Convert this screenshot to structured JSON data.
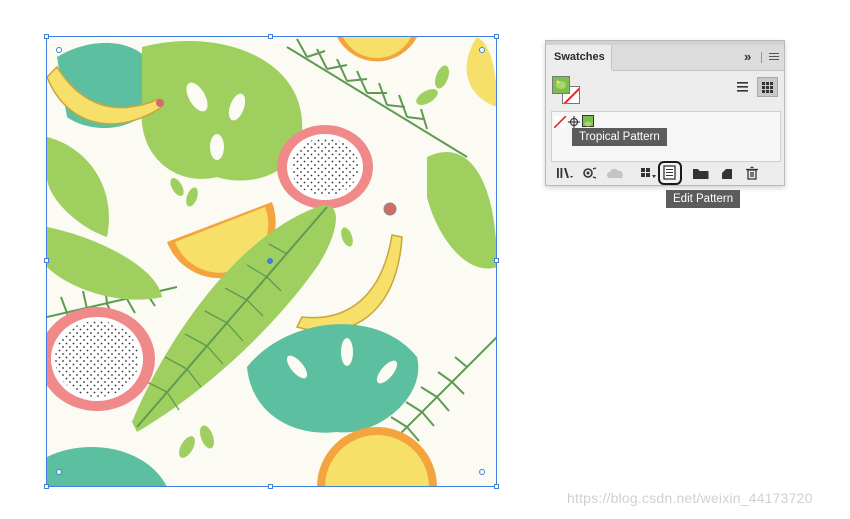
{
  "panel": {
    "tab_label": "Swatches",
    "collapse_glyph": "»",
    "tooltip_swatch_name": "Tropical Pattern",
    "tooltip_edit_pattern": "Edit Pattern",
    "icons": {
      "menu": "panel-menu-icon",
      "list_view": "list-view-icon",
      "thumbnail_view": "thumbnail-view-icon",
      "libraries": "swatch-libraries-icon",
      "color_theme": "color-themes-icon",
      "cloud": "cloud-library-icon",
      "kind": "show-swatch-kinds-icon",
      "edit": "edit-pattern-icon",
      "folder": "new-color-group-icon",
      "new": "new-swatch-icon",
      "delete": "delete-swatch-icon"
    }
  },
  "watermark": "https://blog.csdn.net/weixin_44173720",
  "colors": {
    "selection": "#3f7fe0",
    "pattern_green": "#7cbf4e",
    "teal": "#5cbf9f",
    "lime": "#9fcf5f",
    "pink": "#f08a8a",
    "yellow": "#f6e06a",
    "orange": "#f4a43c"
  }
}
